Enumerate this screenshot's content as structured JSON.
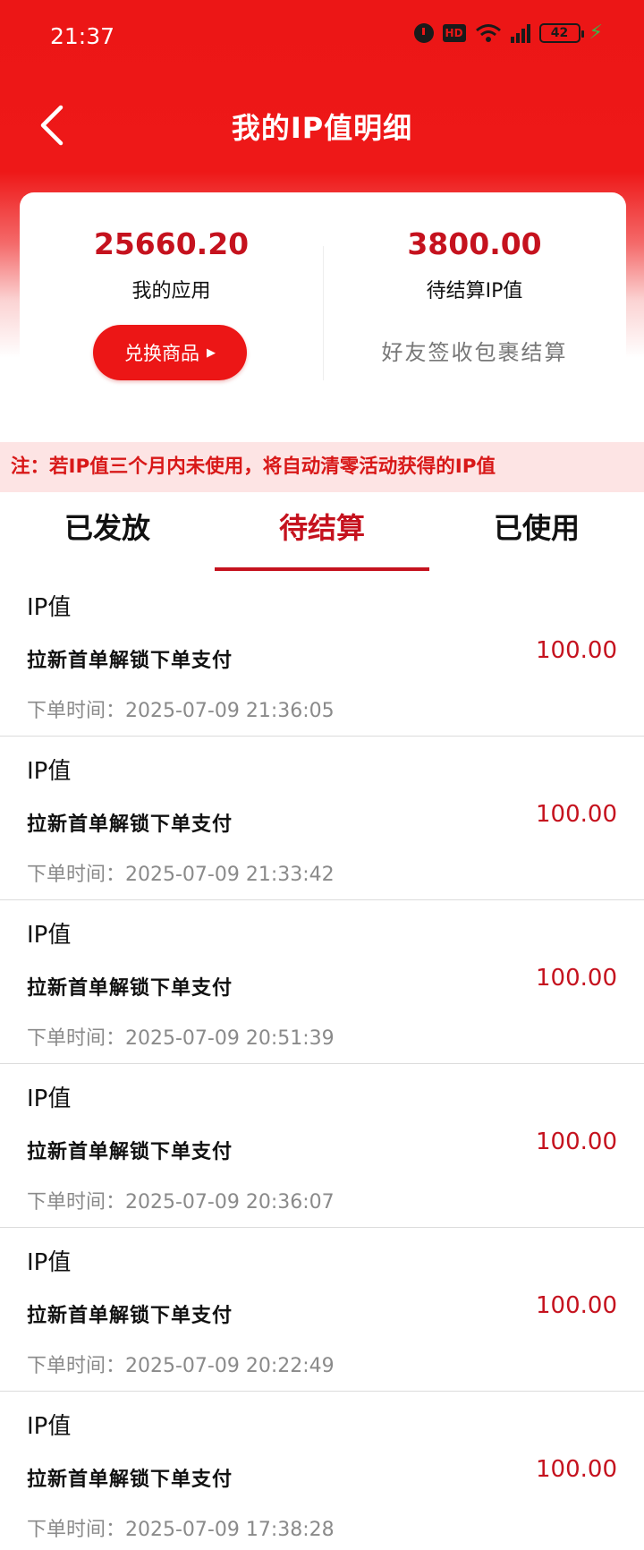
{
  "status_bar": {
    "time": "21:37",
    "hd_label": "HD",
    "battery": "42",
    "icons": [
      "alarm-icon",
      "hd-icon",
      "wifi-icon",
      "signal-icon",
      "battery-icon",
      "charging-icon"
    ]
  },
  "header": {
    "title": "我的IP值明细",
    "back_icon": "chevron-left-icon"
  },
  "summary": {
    "app_value": "25660.20",
    "app_label": "我的应用",
    "exchange_button": "兑换商品",
    "pending_value": "3800.00",
    "pending_label": "待结算IP值",
    "pending_note": "好友签收包裹结算"
  },
  "notice": "注：若IP值三个月内未使用，将自动清零活动获得的IP值",
  "tabs": [
    {
      "label": "已发放",
      "active": false
    },
    {
      "label": "待结算",
      "active": true
    },
    {
      "label": "已使用",
      "active": false
    }
  ],
  "records": [
    {
      "type": "IP值",
      "desc": "拉新首单解锁下单支付",
      "time": "下单时间：2025-07-09 21:36:05",
      "amount": "100.00"
    },
    {
      "type": "IP值",
      "desc": "拉新首单解锁下单支付",
      "time": "下单时间：2025-07-09 21:33:42",
      "amount": "100.00"
    },
    {
      "type": "IP值",
      "desc": "拉新首单解锁下单支付",
      "time": "下单时间：2025-07-09 20:51:39",
      "amount": "100.00"
    },
    {
      "type": "IP值",
      "desc": "拉新首单解锁下单支付",
      "time": "下单时间：2025-07-09 20:36:07",
      "amount": "100.00"
    },
    {
      "type": "IP值",
      "desc": "拉新首单解锁下单支付",
      "time": "下单时间：2025-07-09 20:22:49",
      "amount": "100.00"
    },
    {
      "type": "IP值",
      "desc": "拉新首单解锁下单支付",
      "time": "下单时间：2025-07-09 17:38:28",
      "amount": "100.00"
    }
  ],
  "colors": {
    "brand_red": "#ec1616",
    "amount_red": "#c5121e",
    "notice_bg": "#fde4e4"
  }
}
